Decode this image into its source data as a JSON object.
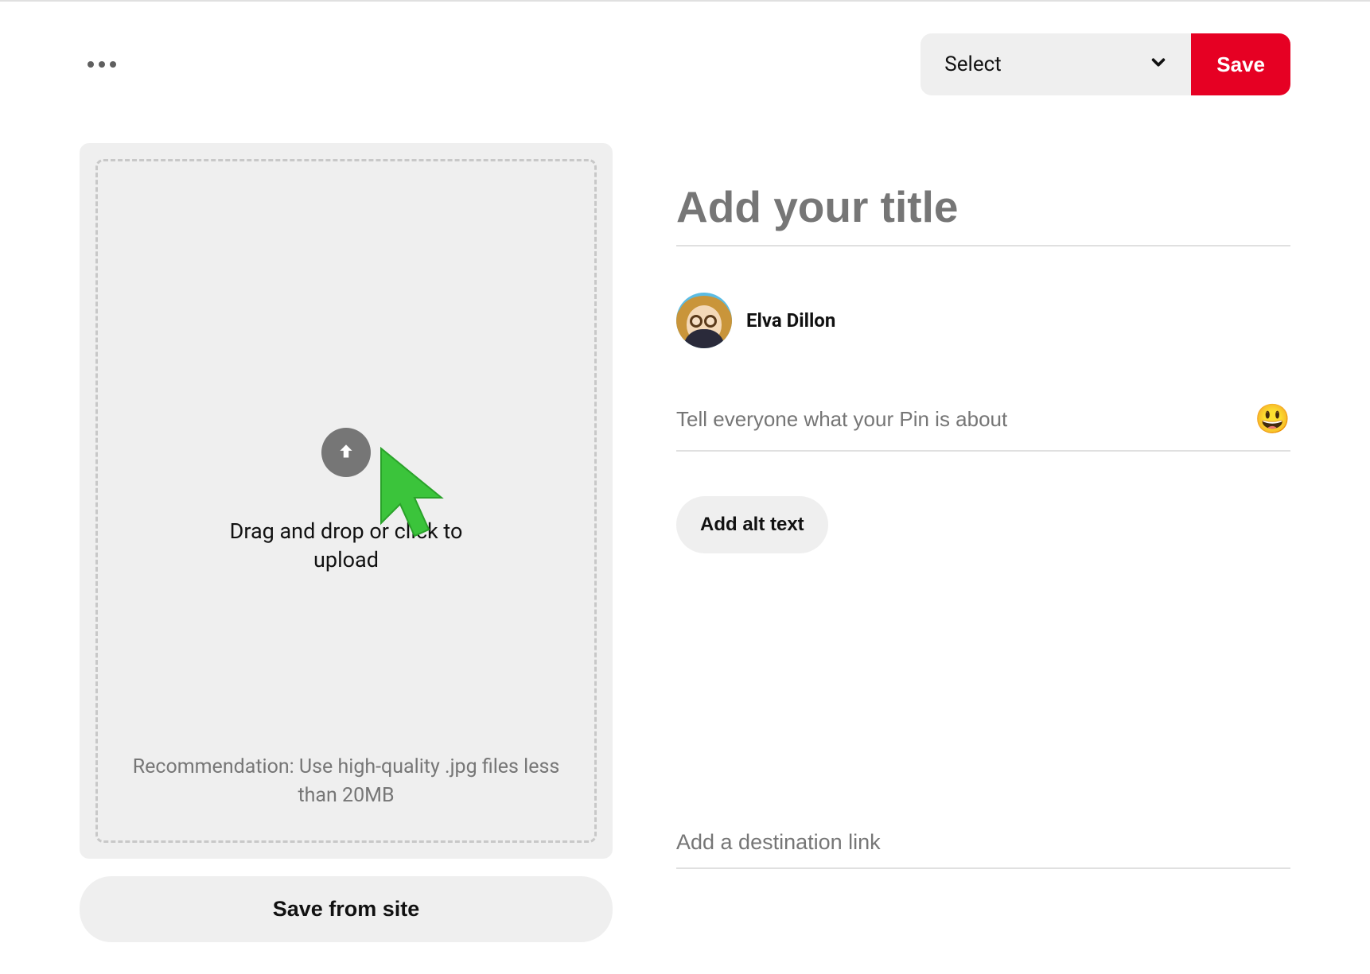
{
  "topbar": {
    "board_select_label": "Select",
    "save_button_label": "Save"
  },
  "upload": {
    "prompt": "Drag and drop or click to upload",
    "recommendation": "Recommendation: Use high-quality .jpg files less than 20MB",
    "save_from_site_label": "Save from site"
  },
  "form": {
    "title_placeholder": "Add your title",
    "description_placeholder": "Tell everyone what your Pin is about",
    "alt_text_button_label": "Add alt text",
    "link_placeholder": "Add a destination link"
  },
  "user": {
    "name": "Elva Dillon"
  },
  "icons": {
    "emoji_glyph": "😃"
  }
}
